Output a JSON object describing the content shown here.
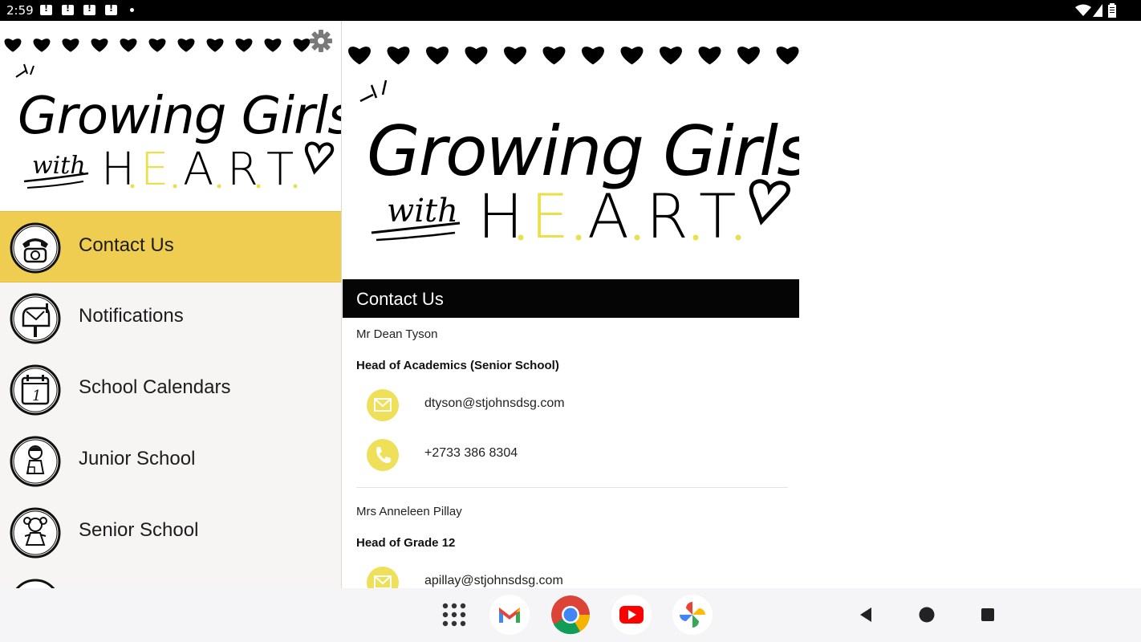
{
  "status_bar": {
    "time": "2:59"
  },
  "sidebar": {
    "banner": {
      "line1": "Growing Girls",
      "line2_prefix": "with",
      "line2_letters": [
        "H",
        "E",
        "A",
        "R",
        "T"
      ]
    },
    "items": [
      {
        "label": "Contact Us",
        "icon": "telephone-icon",
        "active": true
      },
      {
        "label": "Notifications",
        "icon": "mailbox-icon",
        "active": false
      },
      {
        "label": "School Calendars",
        "icon": "calendar-icon",
        "active": false
      },
      {
        "label": "Junior School",
        "icon": "junior-girl-icon",
        "active": false
      },
      {
        "label": "Senior School",
        "icon": "senior-girl-icon",
        "active": false
      }
    ]
  },
  "main": {
    "banner": {
      "line1": "Growing Girls",
      "line2_prefix": "with",
      "line2_letters": [
        "H",
        "E",
        "A",
        "R",
        "T"
      ]
    },
    "section_title": "Contact Us",
    "contacts": [
      {
        "name": "Mr Dean Tyson",
        "role": "Head of Academics (Senior School)",
        "email": "dtyson@stjohnsdsg.com",
        "phone": "+2733 386 8304"
      },
      {
        "name": "Mrs Anneleen Pillay",
        "role": "Head of Grade 12",
        "email": "apillay@stjohnsdsg.com"
      }
    ]
  },
  "colors": {
    "accent": "#efcd50",
    "icon_circle": "#efe05a",
    "header": "#050505"
  },
  "taskbar": {
    "apps": [
      "app-drawer-icon",
      "gmail-icon",
      "chrome-icon",
      "youtube-icon",
      "photos-icon"
    ],
    "nav": [
      "back-icon",
      "home-icon",
      "recents-icon"
    ]
  }
}
